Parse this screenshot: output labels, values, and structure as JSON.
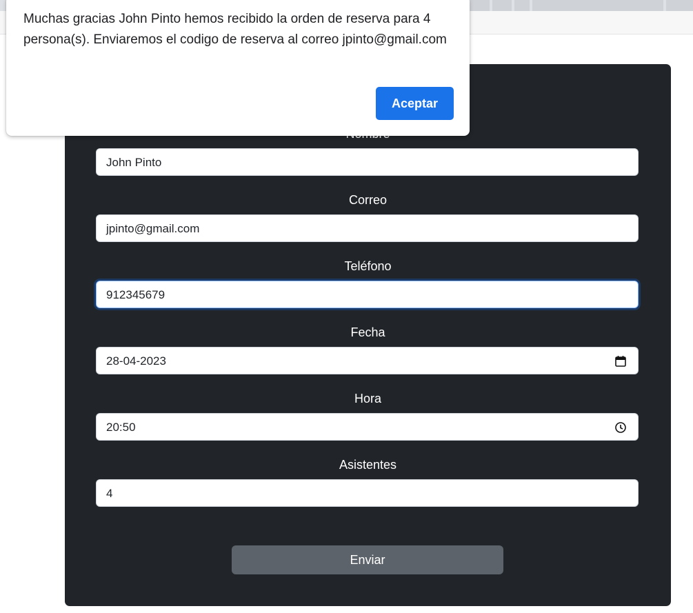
{
  "dialog": {
    "message": "Muchas gracias John Pinto hemos recibido la orden de reserva para 4 persona(s).  Enviaremos el codigo de reserva al correo jpinto@gmail.com",
    "accept_label": "Aceptar"
  },
  "form": {
    "hidden_label": "Nombre",
    "fields": [
      {
        "label": "Nombre",
        "value": "John Pinto"
      },
      {
        "label": "Correo",
        "value": "jpinto@gmail.com"
      },
      {
        "label": "Teléfono",
        "value": "912345679"
      },
      {
        "label": "Fecha",
        "value": "28-04-2023",
        "icon": "calendar-icon"
      },
      {
        "label": "Hora",
        "value": "20:50",
        "icon": "clock-icon"
      },
      {
        "label": "Asistentes",
        "value": "4"
      }
    ],
    "submit_label": "Enviar"
  },
  "colors": {
    "card_bg": "#212529",
    "submit_bg": "#5c636a",
    "accept_bg": "#1a73e8"
  }
}
